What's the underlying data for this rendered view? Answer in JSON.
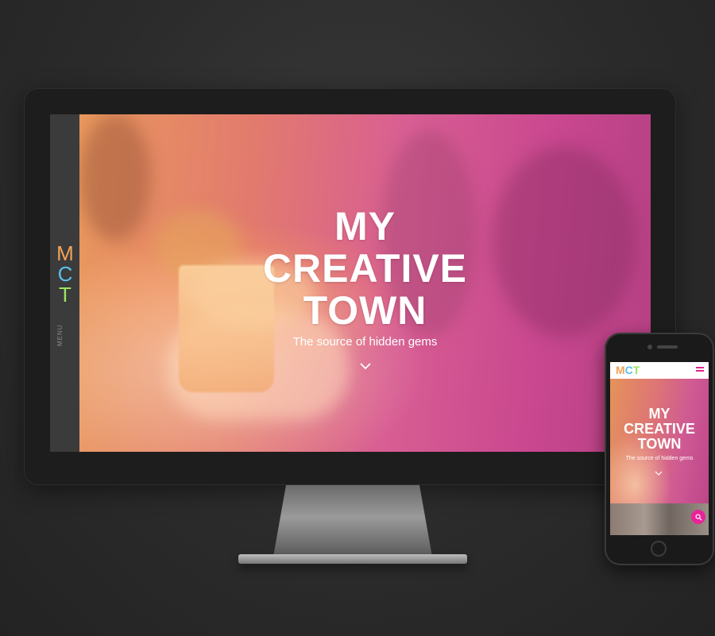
{
  "desktop": {
    "sidebar": {
      "logo_letters": [
        "M",
        "C",
        "T"
      ],
      "logo_colors": [
        "#f4a259",
        "#5bc0eb",
        "#9be564"
      ],
      "menu_label": "MENU"
    },
    "hero": {
      "title_lines": [
        "MY",
        "CREATIVE",
        "TOWN"
      ],
      "subtitle": "The source of hidden gems",
      "scroll_icon": "chevron-down-icon"
    }
  },
  "mobile": {
    "header": {
      "logo": "MCT",
      "logo_colors": [
        "#f4a259",
        "#5bc0eb",
        "#9be564"
      ],
      "menu_icon": "hamburger-icon",
      "menu_icon_color": "#e0248f"
    },
    "hero": {
      "title_lines": [
        "MY",
        "CREATIVE",
        "TOWN"
      ],
      "subtitle": "The source of hidden gems",
      "scroll_icon": "chevron-down-icon"
    },
    "search_button": {
      "icon": "search-icon",
      "color": "#e8239a"
    }
  },
  "colors": {
    "background": "#2b2b2b",
    "accent_pink": "#e0248f",
    "hero_gradient_start": "#e9985d",
    "hero_gradient_end": "#b54083"
  }
}
